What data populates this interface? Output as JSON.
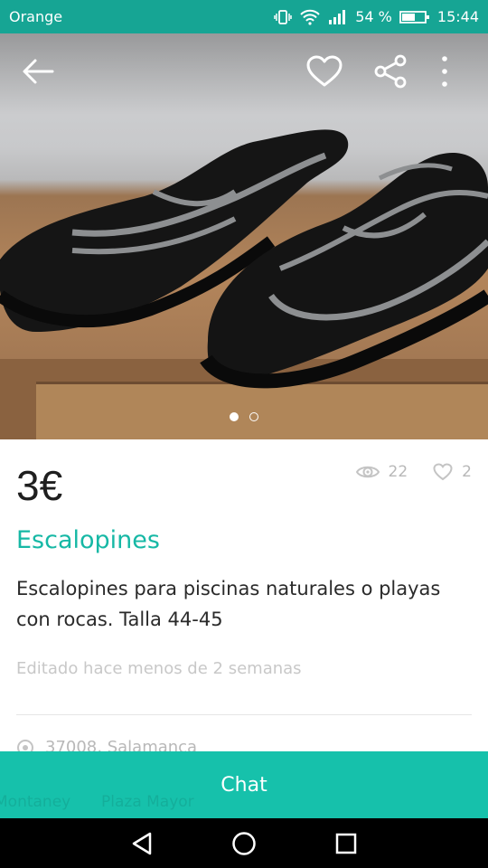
{
  "status_bar": {
    "carrier": "Orange",
    "battery_percent": "54 %",
    "time": "15:44",
    "icons": [
      "vibrate-icon",
      "wifi-icon",
      "signal-icon",
      "battery-icon"
    ]
  },
  "hero": {
    "image_description_icon": "product-photo",
    "actions": {
      "back_icon": "arrow-left-icon",
      "favorite_icon": "heart-outline-icon",
      "share_icon": "share-icon",
      "more_icon": "more-vertical-icon"
    },
    "carousel": {
      "total": 2,
      "active_index": 0
    }
  },
  "listing": {
    "price": "3€",
    "views": "22",
    "likes": "2",
    "title": "Escalopines",
    "description": "Escalopines para piscinas naturales o playas con rocas. Talla 44-45",
    "edited": "Editado hace menos de 2 semanas",
    "location": "37008, Salamanca"
  },
  "chat": {
    "label": "Chat",
    "map_labels": [
      "Montaney",
      "Plaza Mayor"
    ]
  },
  "colors": {
    "status_bar": "#16a594",
    "accent": "#16b8a5",
    "chat_button": "#16c1ab"
  }
}
